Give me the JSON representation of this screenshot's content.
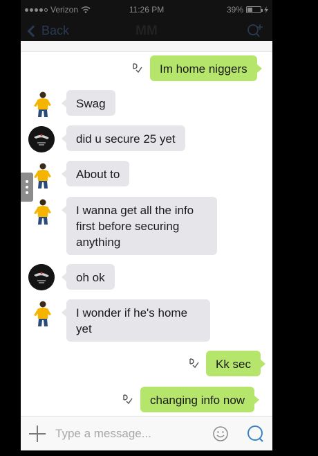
{
  "status_bar": {
    "carrier": "Verizon",
    "time": "11:26 PM",
    "battery": "39%",
    "battery_level": 0.39
  },
  "nav": {
    "back_label": "Back",
    "title": "MM",
    "add_contact_icon": "add-contact-icon"
  },
  "messages": [
    {
      "side": "out",
      "text": "Im home niggers",
      "read_icon": "read-receipt-icon"
    },
    {
      "side": "in",
      "sender": "A",
      "text": "Swag"
    },
    {
      "side": "in",
      "sender": "B",
      "text": "did u secure 25 yet"
    },
    {
      "side": "in",
      "sender": "A",
      "text": "About to"
    },
    {
      "side": "in",
      "sender": "A",
      "text": "I wanna get all the info first before securing anything"
    },
    {
      "side": "in",
      "sender": "B",
      "text": "oh ok"
    },
    {
      "side": "in",
      "sender": "A",
      "text": "I wonder if he's home yet"
    },
    {
      "side": "out",
      "text": "Kk sec",
      "read_icon": "read-receipt-icon"
    },
    {
      "side": "out",
      "text": "changing info now",
      "read_icon": "read-receipt-icon"
    }
  ],
  "input_bar": {
    "placeholder": "Type a message...",
    "value": ""
  },
  "colors": {
    "outgoing_bubble": "#b5e56a",
    "incoming_bubble": "#e6e6ea",
    "accent": "#3b82c4"
  }
}
